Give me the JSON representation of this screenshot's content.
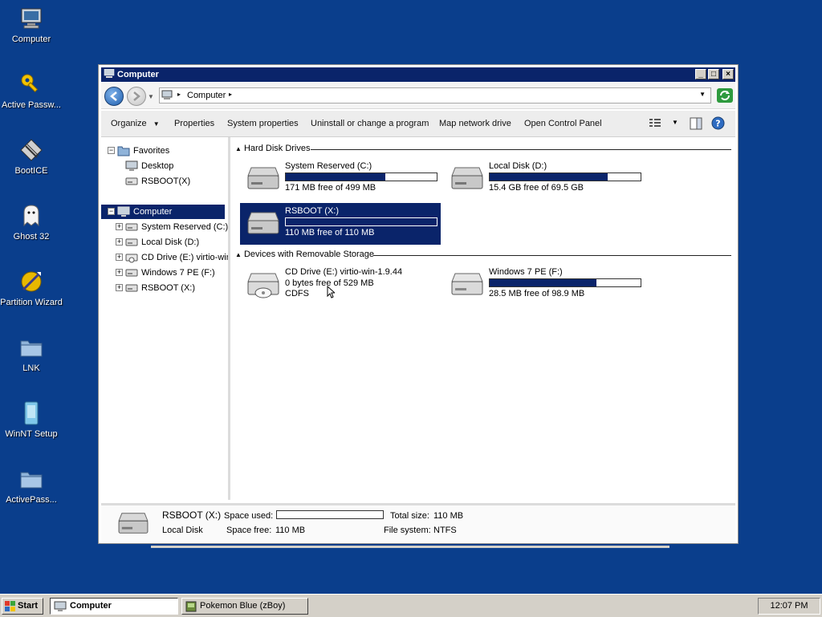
{
  "desktop": {
    "icons": [
      {
        "label": "Computer",
        "icon": "computer-icon"
      },
      {
        "label": "Active Passw...",
        "icon": "key-icon"
      },
      {
        "label": "BootICE",
        "icon": "bootice-icon"
      },
      {
        "label": "Ghost 32",
        "icon": "ghost-icon"
      },
      {
        "label": "Partition Wizard",
        "icon": "partition-wizard-icon"
      },
      {
        "label": "LNK",
        "icon": "folder-icon"
      },
      {
        "label": "WinNT Setup",
        "icon": "winnt-setup-icon"
      },
      {
        "label": "ActivePass...",
        "icon": "folder-icon"
      }
    ]
  },
  "window": {
    "title": "Computer",
    "address": {
      "location": "Computer"
    },
    "toolbar": {
      "organize": "Organize",
      "properties": "Properties",
      "system_properties": "System properties",
      "uninstall": "Uninstall or change a program",
      "map_drive": "Map network drive",
      "control_panel": "Open Control Panel"
    },
    "nav": {
      "favorites": "Favorites",
      "desktop": "Desktop",
      "rsboot_fav": "RSBOOT(X)",
      "computer": "Computer",
      "drives": [
        "System Reserved (C:)",
        "Local Disk (D:)",
        "CD Drive (E:) virtio-win",
        "Windows 7 PE (F:)",
        "RSBOOT (X:)"
      ]
    },
    "content": {
      "hard_disk_header": "Hard Disk Drives",
      "removable_header": "Devices with Removable Storage",
      "hard_disks": [
        {
          "name": "System Reserved (C:)",
          "free": "171 MB free of 499 MB",
          "used_fraction": 0.66
        },
        {
          "name": "Local Disk (D:)",
          "free": "15.4 GB free of 69.5 GB",
          "used_fraction": 0.78
        },
        {
          "name": "RSBOOT (X:)",
          "free": "110 MB free of 110 MB",
          "used_fraction": 0.0
        }
      ],
      "removable": [
        {
          "name": "CD Drive (E:) virtio-win-1.9.44",
          "free": "0 bytes free of 529 MB",
          "fs": "CDFS"
        },
        {
          "name": "Windows 7 PE (F:)",
          "free": "28.5 MB free of 98.9 MB",
          "used_fraction": 0.71
        }
      ]
    },
    "details": {
      "name": "RSBOOT (X:)",
      "type": "Local Disk",
      "space_used_label": "Space used:",
      "space_free_label": "Space free:",
      "space_free": "110 MB",
      "total_size_label": "Total size:",
      "total_size": "110 MB",
      "fs_label": "File system:",
      "fs": "NTFS",
      "used_fraction": 0.0
    }
  },
  "taskbar": {
    "start": "Start",
    "tasks": [
      "Computer",
      "Pokemon Blue (zBoy)"
    ],
    "clock": "12:07 PM"
  },
  "colors": {
    "desktop_bg": "#0a3e8c",
    "selection": "#0a246a"
  }
}
